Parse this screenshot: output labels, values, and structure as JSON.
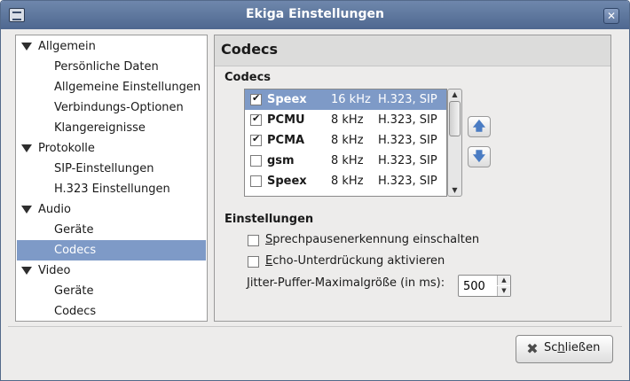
{
  "window": {
    "title": "Ekiga Einstellungen"
  },
  "tree": {
    "items": [
      {
        "label": "Allgemein",
        "level": 0,
        "expanded": true
      },
      {
        "label": "Persönliche Daten",
        "level": 1
      },
      {
        "label": "Allgemeine Einstellungen",
        "level": 1
      },
      {
        "label": "Verbindungs-Optionen",
        "level": 1
      },
      {
        "label": "Klangereignisse",
        "level": 1
      },
      {
        "label": "Protokolle",
        "level": 0,
        "expanded": true
      },
      {
        "label": "SIP-Einstellungen",
        "level": 1
      },
      {
        "label": "H.323 Einstellungen",
        "level": 1
      },
      {
        "label": "Audio",
        "level": 0,
        "expanded": true
      },
      {
        "label": "Geräte",
        "level": 1
      },
      {
        "label": "Codecs",
        "level": 1,
        "selected": true
      },
      {
        "label": "Video",
        "level": 0,
        "expanded": true
      },
      {
        "label": "Geräte",
        "level": 1
      },
      {
        "label": "Codecs",
        "level": 1
      }
    ]
  },
  "panel": {
    "header": "Codecs",
    "codecs_title": "Codecs",
    "codecs": [
      {
        "name": "Speex",
        "rate": "16 kHz",
        "proto": "H.323, SIP",
        "checked": true,
        "selected": true
      },
      {
        "name": "PCMU",
        "rate": "8 kHz",
        "proto": "H.323, SIP",
        "checked": true
      },
      {
        "name": "PCMA",
        "rate": "8 kHz",
        "proto": "H.323, SIP",
        "checked": true
      },
      {
        "name": "gsm",
        "rate": "8 kHz",
        "proto": "H.323, SIP",
        "checked": false
      },
      {
        "name": "Speex",
        "rate": "8 kHz",
        "proto": "H.323, SIP",
        "checked": false
      }
    ],
    "settings_title": "Einstellungen",
    "silence": {
      "underline": "S",
      "rest": "prechpausenerkennung einschalten",
      "checked": false
    },
    "echo": {
      "underline": "E",
      "rest": "cho-Unterdrückung aktivieren",
      "checked": false
    },
    "jitter": {
      "underline": "J",
      "rest": "itter-Puffer-Maximalgröße (in ms):",
      "value": "500"
    }
  },
  "close_button": {
    "pre": "Sc",
    "underline": "h",
    "post": "ließen"
  },
  "icons": {
    "move_up": "arrow-up-icon",
    "move_down": "arrow-down-icon",
    "close": "close-x-icon",
    "expand": "triangle-down-icon"
  }
}
